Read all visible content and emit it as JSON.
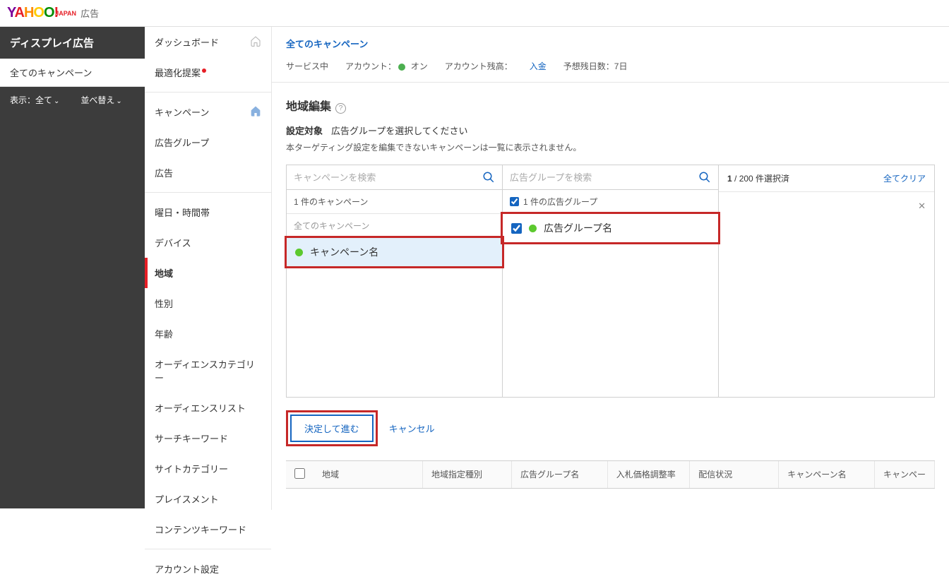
{
  "logo": {
    "text": "YAHOO!",
    "sub": "JAPAN",
    "ad": "広告"
  },
  "left": {
    "title": "ディスプレイ広告",
    "allCampaigns": "全てのキャンペーン",
    "show": "表示：全て",
    "sort": "並べ替え"
  },
  "nav": {
    "dashboard": "ダッシュボード",
    "optimize": "最適化提案",
    "campaign": "キャンペーン",
    "adgroup": "広告グループ",
    "ad": "広告",
    "daytime": "曜日・時間帯",
    "device": "デバイス",
    "region": "地域",
    "gender": "性別",
    "age": "年齢",
    "audcat": "オーディエンスカテゴリー",
    "audlist": "オーディエンスリスト",
    "searchkw": "サーチキーワード",
    "sitecat": "サイトカテゴリー",
    "placement": "プレイスメント",
    "contentkw": "コンテンツキーワード",
    "account": "アカウント設定"
  },
  "crumb": "全てのキャンペーン",
  "status": {
    "serving": "サービス中",
    "accountLabel": "アカウント：",
    "on": "オン",
    "balanceLabel": "アカウント残高：",
    "deposit": "入金",
    "daysLabel": "予想残日数：",
    "days": "7日"
  },
  "edit": {
    "title": "地域編集",
    "targetLabel": "設定対象",
    "targetText": "広告グループを選択してください",
    "note": "本ターゲティング設定を編集できないキャンペーンは一覧に表示されません。",
    "searchCampaign": "キャンペーンを検索",
    "searchAdgroup": "広告グループを検索",
    "campaignCount": "1 件のキャンペーン",
    "adgroupCount": "1 件の広告グループ",
    "allCampaigns": "全てのキャンペーン",
    "campaignName": "キャンペーン名",
    "adgroupName": "広告グループ名",
    "selectedCount": "1 / 200 件選択済",
    "clearAll": "全てクリア",
    "close": "✕",
    "proceed": "決定して進む",
    "cancel": "キャンセル"
  },
  "table": {
    "c1": "地域",
    "c2": "地域指定種別",
    "c3": "広告グループ名",
    "c4": "入札価格調整率",
    "c5": "配信状況",
    "c6": "キャンペーン名",
    "c7": "キャンペー"
  }
}
